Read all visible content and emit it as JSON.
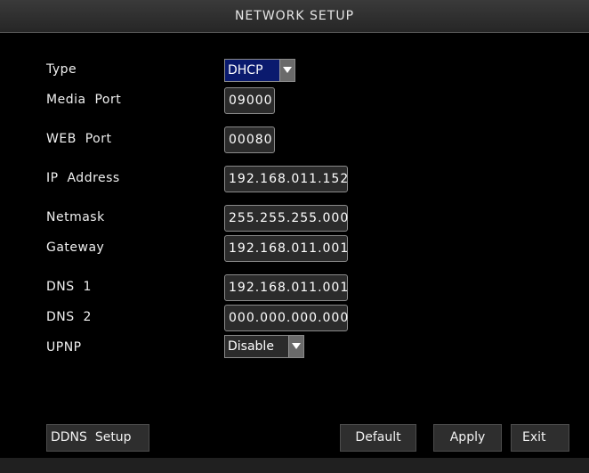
{
  "window": {
    "title": "NETWORK SETUP"
  },
  "fields": {
    "type": {
      "label": "Type",
      "value": "DHCP"
    },
    "media_port": {
      "label": "Media  Port",
      "value": "09000"
    },
    "web_port": {
      "label": "WEB  Port",
      "value": "00080"
    },
    "ip_address": {
      "label": "IP  Address",
      "value": "192.168.011.152"
    },
    "netmask": {
      "label": "Netmask",
      "value": "255.255.255.000"
    },
    "gateway": {
      "label": "Gateway",
      "value": "192.168.011.001"
    },
    "dns1": {
      "label": "DNS  1",
      "value": "192.168.011.001"
    },
    "dns2": {
      "label": "DNS  2",
      "value": "000.000.000.000"
    },
    "upnp": {
      "label": "UPNP",
      "value": "Disable"
    }
  },
  "buttons": {
    "ddns_setup": "DDNS  Setup",
    "default": "Default",
    "apply": "Apply",
    "exit": "Exit"
  },
  "colors": {
    "background": "#000000",
    "field_bg": "#2b2b2b",
    "select_highlight": "#0a1a6e",
    "button_bg": "#2e2e2e"
  }
}
